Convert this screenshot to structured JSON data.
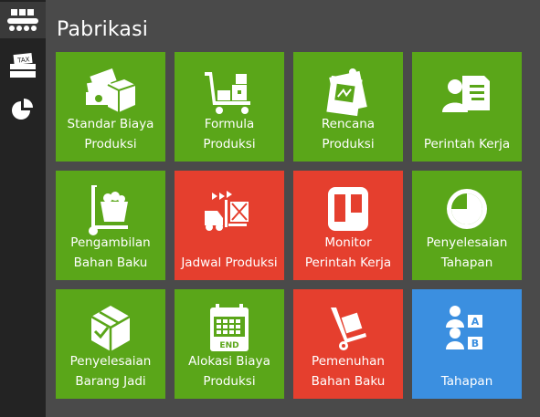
{
  "sidebar": {
    "items": [
      {
        "name": "factory-icon",
        "active": true
      },
      {
        "name": "tax-icon",
        "active": false
      },
      {
        "name": "pie-chart-icon",
        "active": false
      }
    ]
  },
  "main": {
    "title": "Pabrikasi",
    "tiles": [
      {
        "label": "Standar Biaya\nProduksi",
        "color": "#5aa619",
        "icon": "money-box-icon"
      },
      {
        "label": "Formula\nProduksi",
        "color": "#5aa619",
        "icon": "cart-boxes-icon"
      },
      {
        "label": "Rencana\nProduksi",
        "color": "#5aa619",
        "icon": "pinned-plan-icon"
      },
      {
        "label": "Perintah Kerja",
        "color": "#5aa619",
        "icon": "id-card-icon"
      },
      {
        "label": "Pengambilan\nBahan Baku",
        "color": "#5aa619",
        "icon": "hand-truck-icon"
      },
      {
        "label": "Jadwal Produksi",
        "color": "#e53f2e",
        "icon": "forklift-icon"
      },
      {
        "label": "Monitor\nPerintah Kerja",
        "color": "#e53f2e",
        "icon": "kanban-board-icon"
      },
      {
        "label": "Penyelesaian\nTahapan",
        "color": "#5aa619",
        "icon": "progress-clock-icon"
      },
      {
        "label": "Penyelesaian\nBarang Jadi",
        "color": "#5aa619",
        "icon": "finished-box-icon"
      },
      {
        "label": "Alokasi Biaya\nProduksi",
        "color": "#5aa619",
        "icon": "calendar-end-icon"
      },
      {
        "label": "Pemenuhan\nBahan Baku",
        "color": "#e53f2e",
        "icon": "dolly-icon"
      },
      {
        "label": "Tahapan",
        "color": "#3b8fe0",
        "icon": "stages-ab-icon"
      }
    ],
    "end_badge": "END",
    "stage_letters": [
      "A",
      "B"
    ]
  }
}
